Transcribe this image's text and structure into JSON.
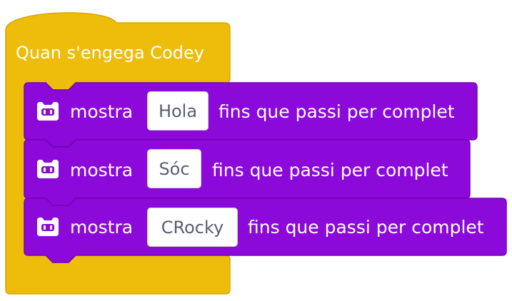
{
  "colors": {
    "event_block": "#eebc0b",
    "event_block_border": "#d6a706",
    "looks_block": "#8b09d9",
    "looks_block_border": "#7205b4",
    "text_white": "#ffffff",
    "field_text": "#575e75"
  },
  "event_block": {
    "label": "Quan s'engega Codey"
  },
  "blocks": [
    {
      "icon": "codey-robot-icon",
      "verb": "mostra",
      "value": "Hola",
      "suffix": "fins que passi per complet"
    },
    {
      "icon": "codey-robot-icon",
      "verb": "mostra",
      "value": "Sóc",
      "suffix": "fins que passi per complet"
    },
    {
      "icon": "codey-robot-icon",
      "verb": "mostra",
      "value": "CRocky",
      "suffix": "fins que passi per complet"
    }
  ]
}
